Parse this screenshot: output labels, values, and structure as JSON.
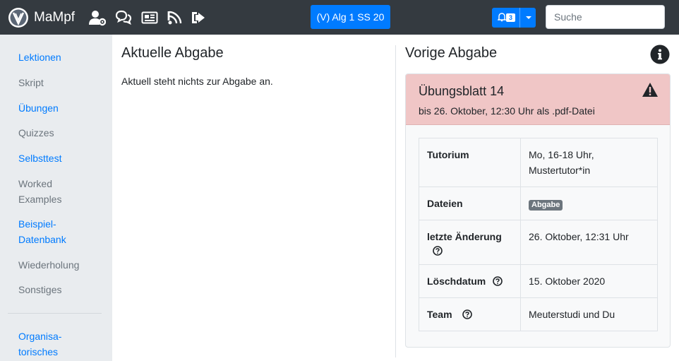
{
  "navbar": {
    "brand_name": "MaMpf",
    "lecture_button": "(V) Alg 1 SS 20",
    "notification_count": "3",
    "search_placeholder": "Suche"
  },
  "sidebar": {
    "items": [
      {
        "label": "Lektionen",
        "link": true
      },
      {
        "label": "Skript",
        "link": false
      },
      {
        "label": "Übungen",
        "link": true
      },
      {
        "label": "Quizzes",
        "link": false
      },
      {
        "label": "Selbsttest",
        "link": true
      },
      {
        "label": "Worked Examples",
        "link": false
      },
      {
        "label": "Beispiel-Datenbank",
        "link": true
      },
      {
        "label": "Wiederholung",
        "link": false
      },
      {
        "label": "Sonstiges",
        "link": false
      },
      {
        "label": "Organisa-torisches",
        "link": true
      }
    ]
  },
  "current": {
    "heading": "Aktuelle Abgabe",
    "text": "Aktuell steht nichts zur Abgabe an."
  },
  "previous": {
    "heading": "Vorige Abgabe",
    "card_title": "Übungsblatt 14",
    "card_subtitle": "bis 26. Oktober, 12:30 Uhr als .pdf-Datei",
    "header_color": "#f0c6c6",
    "rows": [
      {
        "key": "Tutorium",
        "value": "Mo, 16-18 Uhr, Mustertutor*in"
      },
      {
        "key": "Dateien",
        "badge": "Abgabe"
      },
      {
        "key": "letzte Änderung",
        "value": "26. Oktober, 12:31 Uhr"
      },
      {
        "key": "Löschdatum",
        "value": "15. Oktober 2020"
      },
      {
        "key": "Team",
        "value": "Meuterstudi und Du"
      }
    ]
  },
  "colors": {
    "navbar_bg": "#343a40",
    "accent": "#007bff",
    "sidebar_bg": "#e9ecef",
    "muted": "#6c757d"
  },
  "icons": [
    "logo-icon",
    "user-cog-icon",
    "comments-icon",
    "newspaper-icon",
    "feed-icon",
    "sign-out-icon",
    "bell-icon",
    "info-circle-icon",
    "warning-triangle-icon",
    "question-circle-icon"
  ]
}
